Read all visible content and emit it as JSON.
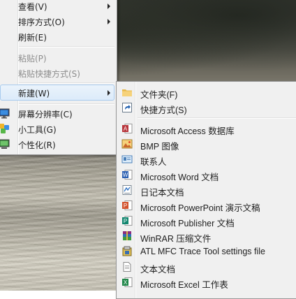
{
  "context_menu": {
    "items": [
      {
        "label": "查看(V)",
        "disabled": false,
        "submenu": true
      },
      {
        "label": "排序方式(O)",
        "disabled": false,
        "submenu": true
      },
      {
        "label": "刷新(E)",
        "disabled": false
      },
      {
        "label": "粘贴(P)",
        "disabled": true
      },
      {
        "label": "粘贴快捷方式(S)",
        "disabled": true
      },
      {
        "label": "新建(W)",
        "disabled": false,
        "submenu": true,
        "highlighted": true
      },
      {
        "label": "屏幕分辨率(C)",
        "icon": "display-icon"
      },
      {
        "label": "小工具(G)",
        "icon": "gadgets-icon"
      },
      {
        "label": "个性化(R)",
        "icon": "personalize-icon"
      }
    ]
  },
  "new_submenu": {
    "items": [
      {
        "label": "文件夹(F)",
        "icon": "folder-icon"
      },
      {
        "label": "快捷方式(S)",
        "icon": "shortcut-icon"
      },
      {
        "label": "Microsoft Access 数据库",
        "icon": "access-icon"
      },
      {
        "label": "BMP 图像",
        "icon": "bmp-image-icon"
      },
      {
        "label": "联系人",
        "icon": "contact-icon"
      },
      {
        "label": "Microsoft Word 文档",
        "icon": "word-icon"
      },
      {
        "label": "日记本文档",
        "icon": "journal-icon"
      },
      {
        "label": "Microsoft PowerPoint 演示文稿",
        "icon": "powerpoint-icon"
      },
      {
        "label": "Microsoft Publisher 文档",
        "icon": "publisher-icon"
      },
      {
        "label": "WinRAR 压缩文件",
        "icon": "winrar-icon"
      },
      {
        "label": "ATL MFC Trace Tool settings file",
        "icon": "atl-trace-icon"
      },
      {
        "label": "文本文档",
        "icon": "text-document-icon"
      },
      {
        "label": "Microsoft Excel 工作表",
        "icon": "excel-icon"
      }
    ]
  },
  "colors": {
    "menu_bg": "#f0f0f0",
    "highlight_border": "#a8cbee",
    "disabled_text": "#8d8d8d"
  }
}
